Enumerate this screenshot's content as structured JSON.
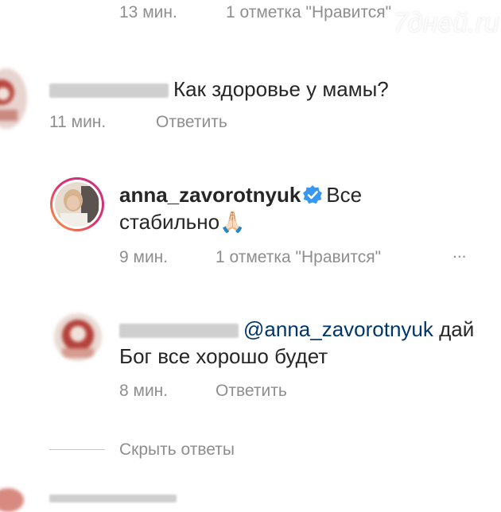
{
  "top_meta": {
    "time": "13 мин.",
    "likes": "1 отметка \"Нравится\""
  },
  "watermark": "7дней.ru",
  "comment1": {
    "text": "Как здоровье у мамы?",
    "time": "11 мин.",
    "reply_label": "Ответить"
  },
  "reply1": {
    "username": "anna_zavorotnyuk",
    "text_line1": "Все",
    "text_line2": "стабильно",
    "emoji": "🙏🏻",
    "time": "9 мин.",
    "likes": "1 отметка \"Нравится\"",
    "more": "..."
  },
  "reply2": {
    "mention": "@anna_zavorotnyuk",
    "text_tail": "дай",
    "text_line2": "Бог все хорошо будет",
    "time": "8 мин.",
    "reply_label": "Ответить"
  },
  "hide_replies": "Скрыть ответы",
  "colors": {
    "text": "#262626",
    "meta": "#8e8e8e",
    "mention": "#00376b",
    "verified": "#3897f0"
  }
}
